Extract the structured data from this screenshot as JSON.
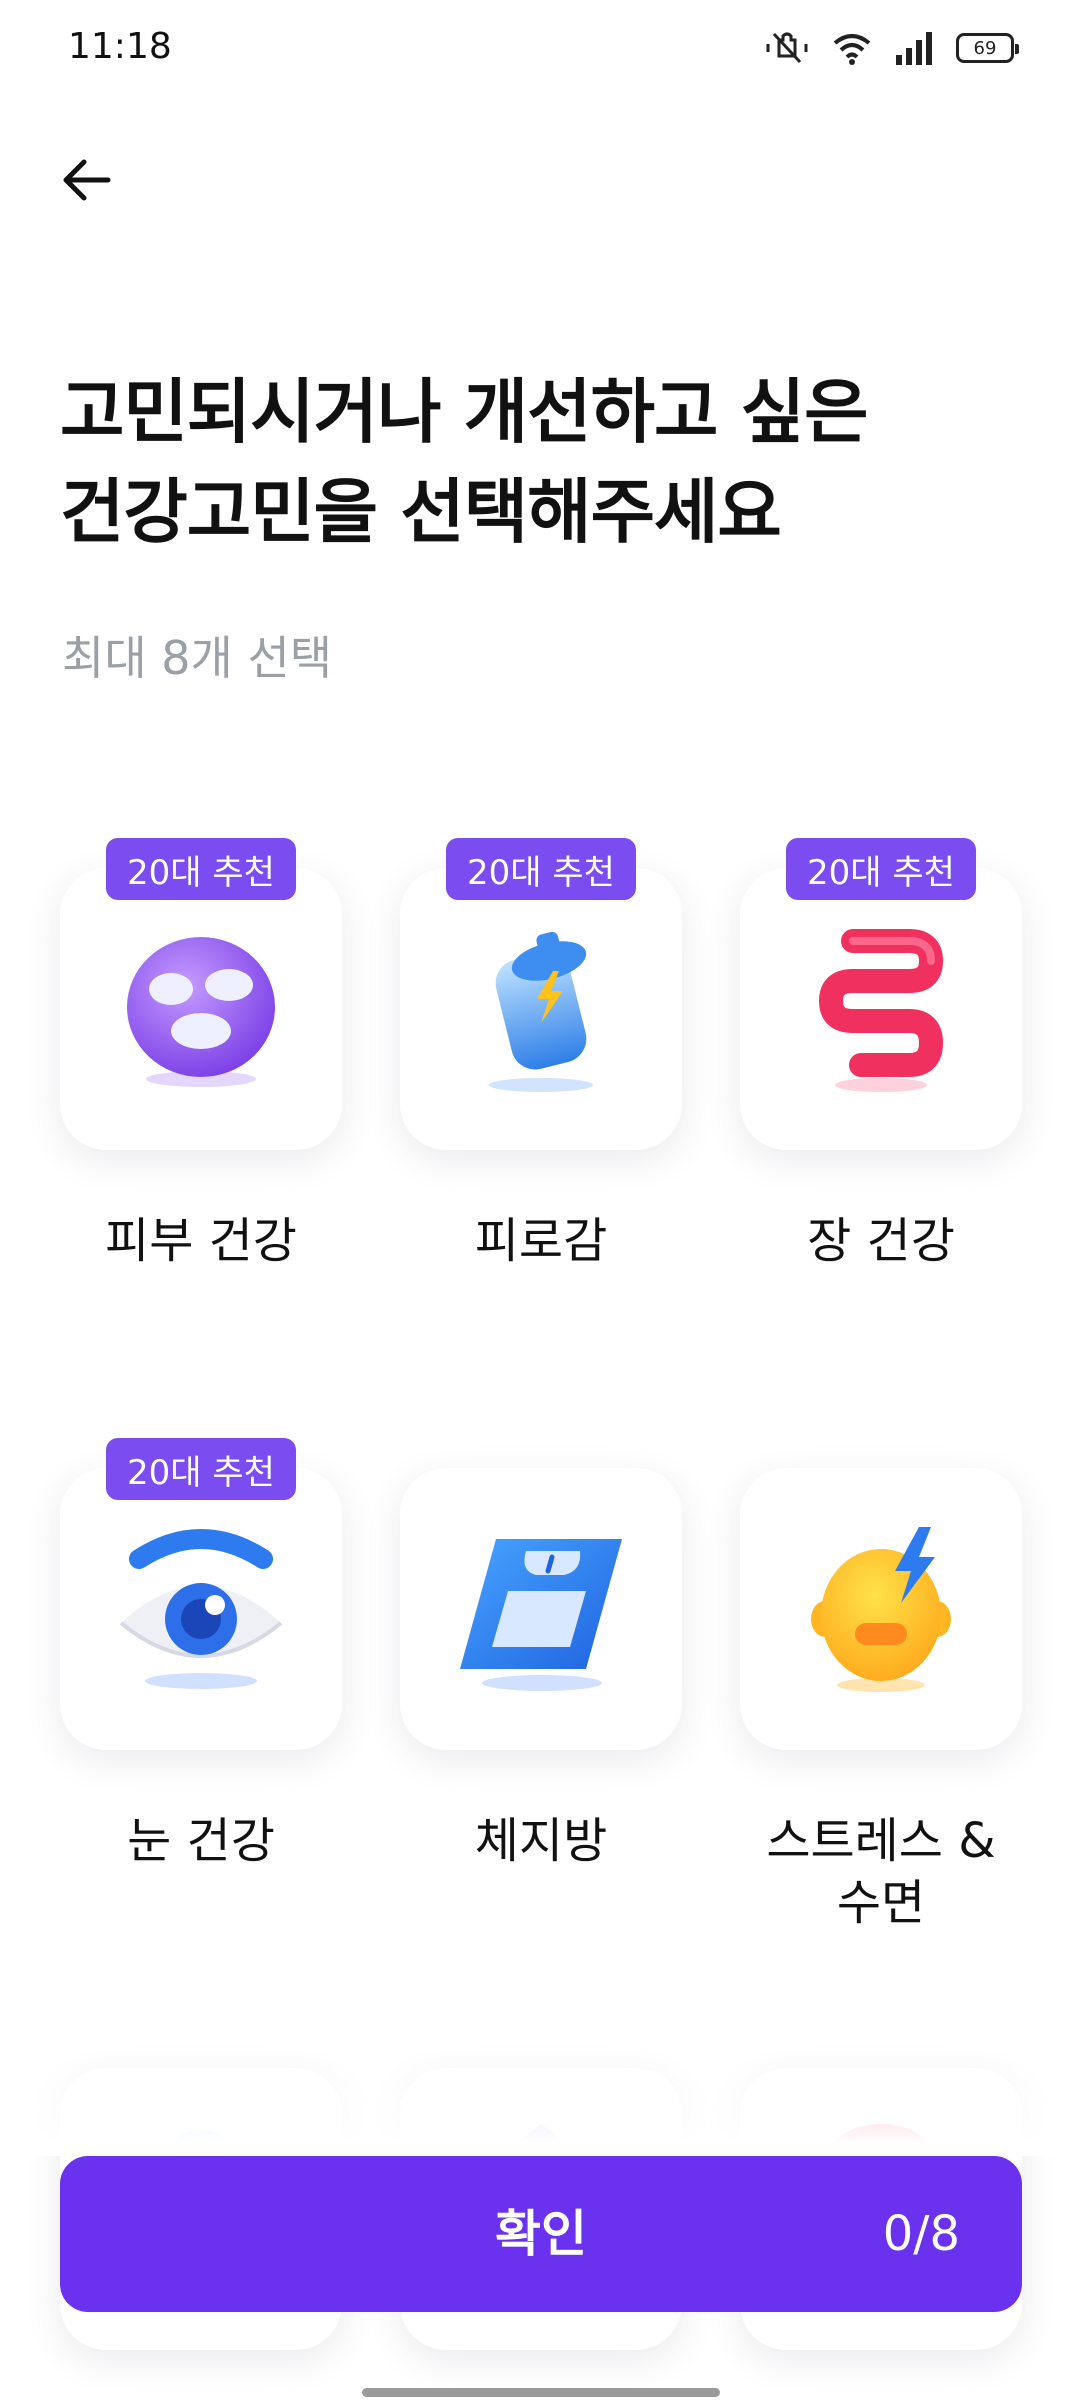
{
  "status_bar": {
    "time": "11:18",
    "battery": "69"
  },
  "header": {
    "title_line1": "고민되시거나 개선하고 싶은",
    "title_line2": "건강고민을 선택해주세요",
    "subtitle": "최대 8개 선택"
  },
  "categories": [
    {
      "label": "피부 건강",
      "badge": "20대 추천",
      "icon": "skin-mask-icon"
    },
    {
      "label": "피로감",
      "badge": "20대 추천",
      "icon": "battery-energy-icon"
    },
    {
      "label": "장 건강",
      "badge": "20대 추천",
      "icon": "intestine-icon"
    },
    {
      "label": "눈 건강",
      "badge": "20대 추천",
      "icon": "eye-icon"
    },
    {
      "label": "체지방",
      "badge": "",
      "icon": "scale-icon"
    },
    {
      "label": "스트레스 &\n수면",
      "badge": "",
      "icon": "stressed-head-icon"
    }
  ],
  "confirm": {
    "label": "확인",
    "count": "0/8"
  },
  "colors": {
    "accent": "#6a31ef",
    "badge": "#7b4cf0",
    "subtitle": "#9aa0a6"
  }
}
